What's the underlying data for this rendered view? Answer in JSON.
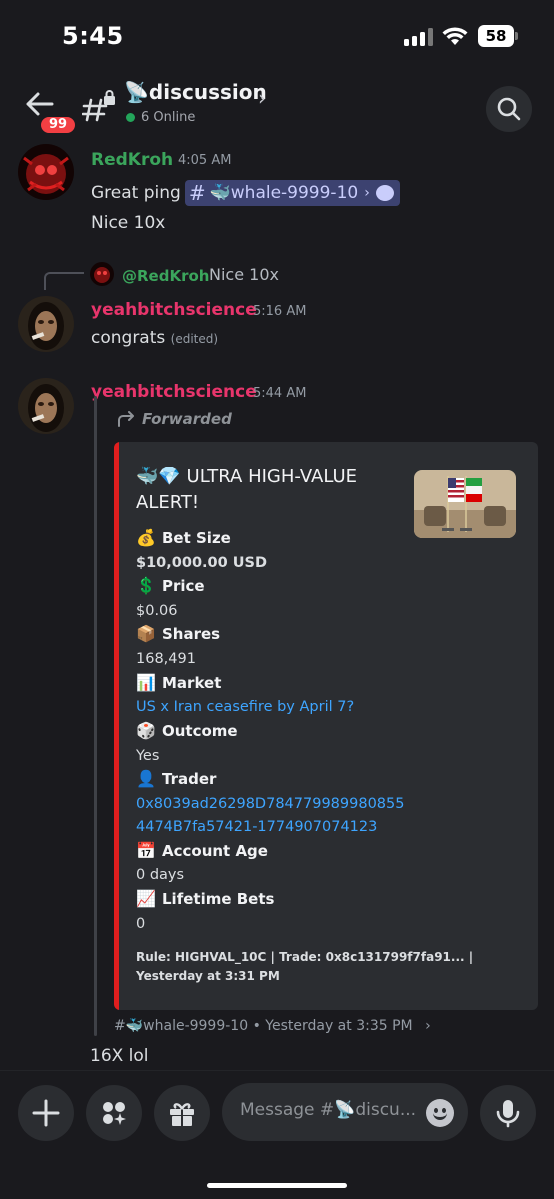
{
  "status_bar": {
    "time": "5:45",
    "battery": "58"
  },
  "header": {
    "back_badge": "99",
    "channel_name": "📡discussion",
    "online": "6 Online"
  },
  "messages": [
    {
      "author": "RedKroh",
      "author_color": "#3ba55c",
      "time": "4:05 AM",
      "lines": [
        "Great ping",
        "Nice 10x"
      ],
      "ping_channel": "🐳whale-9999-10"
    },
    {
      "author": "yeahbitchscience",
      "author_color": "#e8356c",
      "time": "5:16 AM",
      "reply_to": {
        "mention": "@RedKroh",
        "text": "Nice 10x"
      },
      "text": "congrats",
      "edited": "(edited)"
    },
    {
      "author": "yeahbitchscience",
      "author_color": "#e8356c",
      "time": "5:44 AM",
      "forwarded_label": "Forwarded",
      "embed": {
        "accent": "#e01e1e",
        "title": "🐳💎 ULTRA HIGH-VALUE ALERT!",
        "fields": [
          {
            "icon": "💰",
            "name": "Bet Size",
            "value": "$10,000.00 USD",
            "bold": true
          },
          {
            "icon": "💲",
            "name": "Price",
            "value": "$0.06"
          },
          {
            "icon": "📦",
            "name": "Shares",
            "value": "168,491"
          },
          {
            "icon": "📊",
            "name": "Market",
            "value": "US x Iran ceasefire by April 7?",
            "link": true
          },
          {
            "icon": "🎲",
            "name": "Outcome",
            "value": "Yes"
          },
          {
            "icon": "👤",
            "name": "Trader",
            "value_lines": [
              "0x8039ad26298D784779989980855",
              "4474B7fa57421-1774907074123"
            ],
            "link": true
          },
          {
            "icon": "📅",
            "name": "Account Age",
            "value": "0 days"
          },
          {
            "icon": "📈",
            "name": "Lifetime Bets",
            "value": "0"
          }
        ],
        "footer": "Rule: HIGHVAL_10C | Trade: 0x8c131799f7fa91... | Yesterday at 3:31 PM"
      },
      "source": "#🐳whale-9999-10 • Yesterday at 3:35 PM"
    },
    {
      "text": "16X lol"
    }
  ],
  "composer": {
    "placeholder": "Message #📡discu..."
  }
}
